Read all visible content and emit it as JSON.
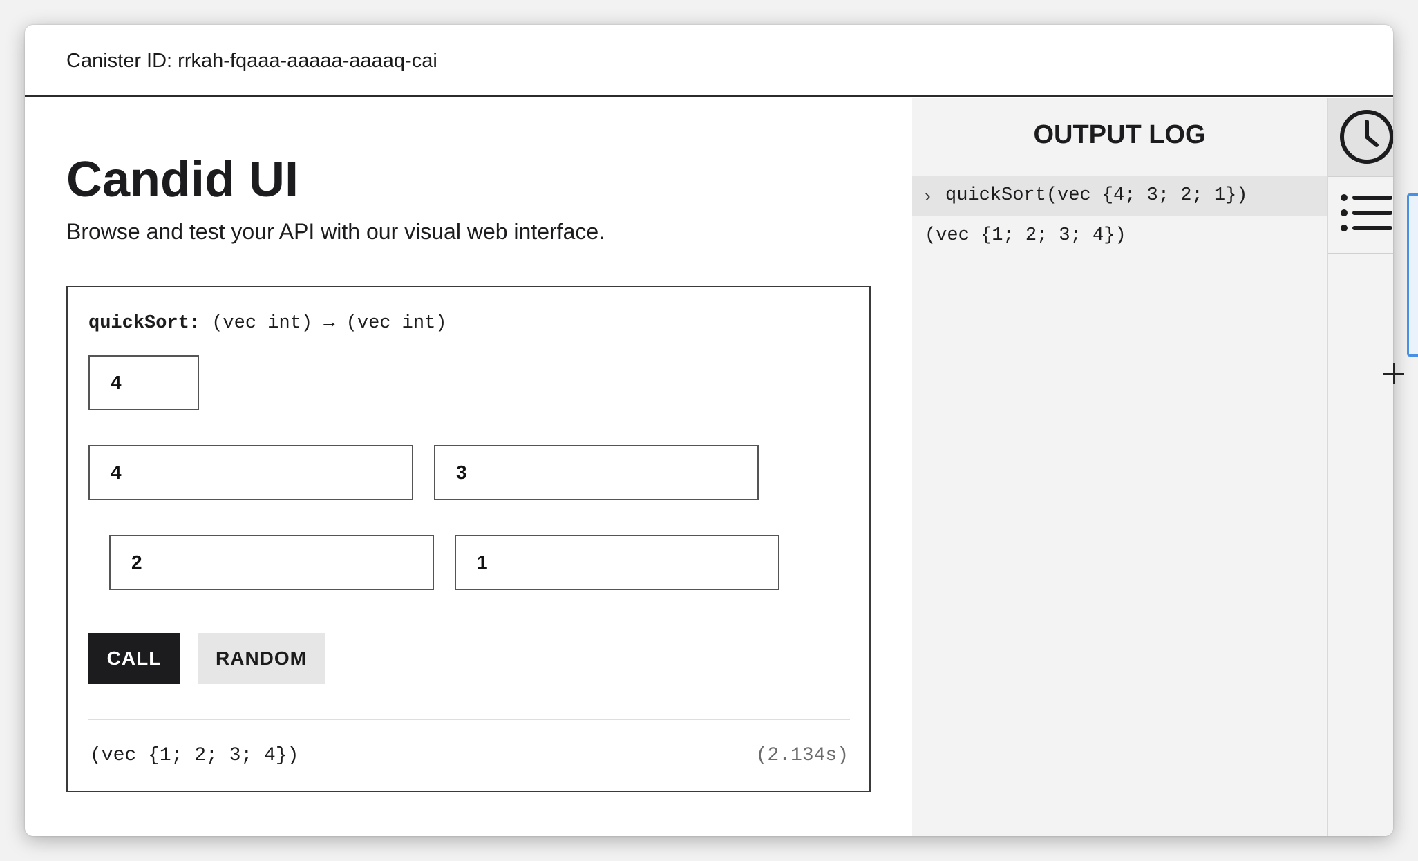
{
  "header": {
    "canister_id": "Canister ID: rrkah-fqaaa-aaaaa-aaaaq-cai"
  },
  "main": {
    "title": "Candid UI",
    "subtitle": "Browse and test your API with our visual web interface."
  },
  "method": {
    "name": "quickSort:",
    "signature": " (vec int) → (vec int)",
    "inputs": {
      "length": "4",
      "items": [
        "4",
        "3",
        "2",
        "1"
      ]
    },
    "call_label": "CALL",
    "random_label": "RANDOM",
    "result": "(vec {1; 2; 3; 4})",
    "duration": "(2.134s)"
  },
  "output_log": {
    "title": "OUTPUT LOG",
    "chevron": "›",
    "call": "quickSort(vec {4; 3; 2; 1})",
    "result": "(vec {1; 2; 3; 4})"
  },
  "side_rail": {
    "icons": [
      "clock-icon",
      "list-icon"
    ]
  },
  "colors": {
    "primary_button": "#1c1c1e",
    "secondary_button": "#e6e6e6",
    "output_bg": "#f3f3f4"
  }
}
